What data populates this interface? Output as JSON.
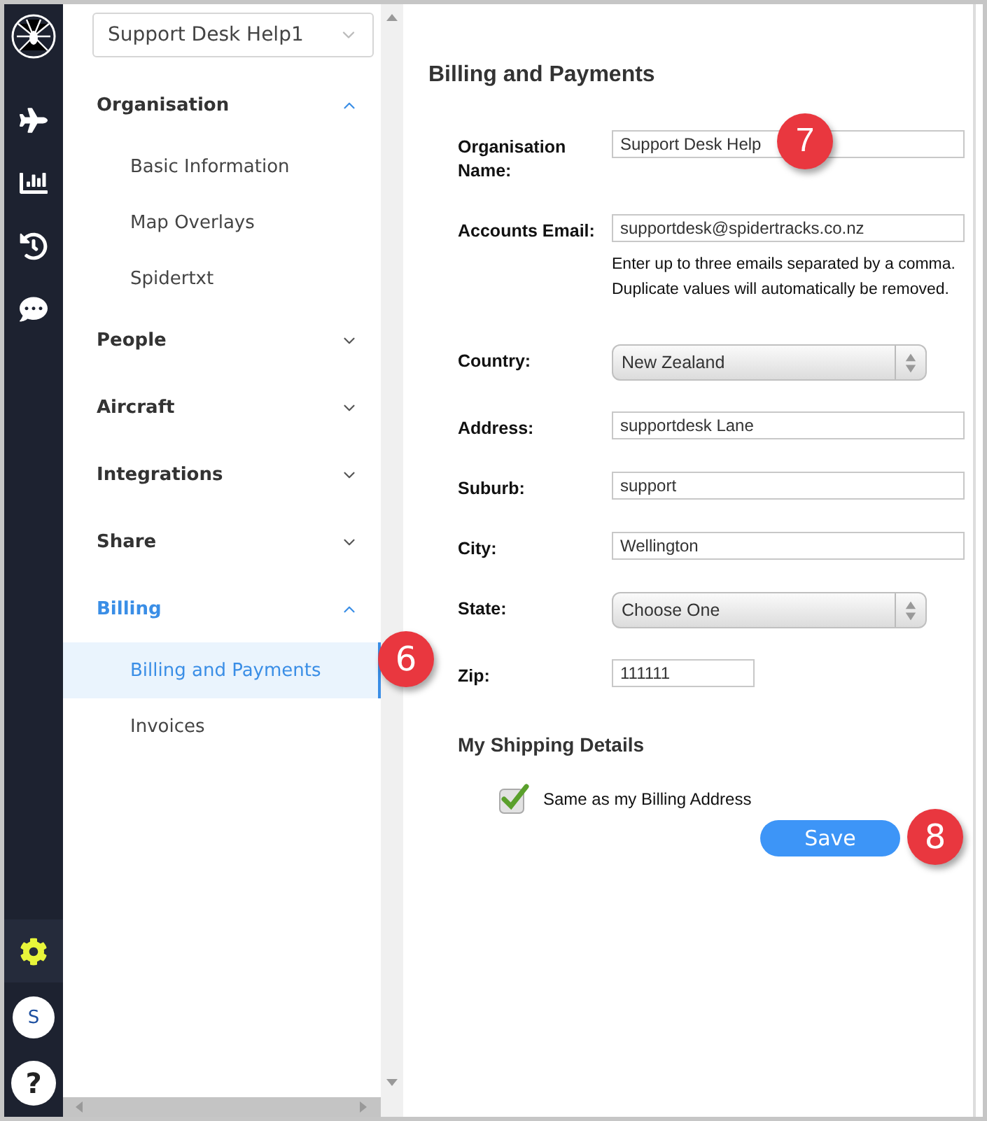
{
  "rail": {
    "items": [
      {
        "kind": "plane",
        "selected": false
      },
      {
        "kind": "chart",
        "selected": false
      },
      {
        "kind": "history",
        "selected": false
      },
      {
        "kind": "message",
        "selected": false
      }
    ],
    "bottom": [
      {
        "kind": "settings",
        "selected": true
      }
    ],
    "avatar": "S",
    "help": "?"
  },
  "account_select": {
    "value": "Support Desk Help1"
  },
  "nav": [
    {
      "label": "Organisation",
      "expanded": true,
      "children": [
        {
          "label": "Basic Information",
          "selected": false
        },
        {
          "label": "Map Overlays",
          "selected": false
        },
        {
          "label": "Spidertxt",
          "selected": false
        }
      ]
    },
    {
      "label": "People",
      "expanded": false
    },
    {
      "label": "Aircraft",
      "expanded": false
    },
    {
      "label": "Integrations",
      "expanded": false
    },
    {
      "label": "Share",
      "expanded": false
    },
    {
      "label": "Billing",
      "expanded": true,
      "children": [
        {
          "label": "Billing and Payments",
          "selected": true
        },
        {
          "label": "Invoices",
          "selected": false
        }
      ]
    }
  ],
  "page": {
    "title": "Billing and Payments",
    "fields": [
      {
        "kind": "text",
        "label": "Organisation Name:",
        "value": "Support Desk Help",
        "callout": "7"
      },
      {
        "kind": "text",
        "label": "Accounts Email:",
        "value": "supportdesk@spidertracks.co.nz",
        "help": [
          "Enter up to three emails separated by a comma.",
          "Duplicate values will automatically be removed."
        ]
      },
      {
        "kind": "select",
        "label": "Country:",
        "value": "New Zealand"
      },
      {
        "kind": "text",
        "label": "Address:",
        "value": "supportdesk Lane"
      },
      {
        "kind": "text",
        "label": "Suburb:",
        "value": "support"
      },
      {
        "kind": "text",
        "label": "City:",
        "value": "Wellington"
      },
      {
        "kind": "select",
        "label": "State:",
        "value": "Choose One"
      },
      {
        "kind": "short",
        "label": "Zip:",
        "value": "111111"
      }
    ],
    "shipping_title": "My Shipping Details",
    "same_as_billing": {
      "label": "Same as my Billing Address",
      "checked": true
    },
    "save": "Save",
    "save_callout": "8"
  },
  "nav_callout": "6"
}
